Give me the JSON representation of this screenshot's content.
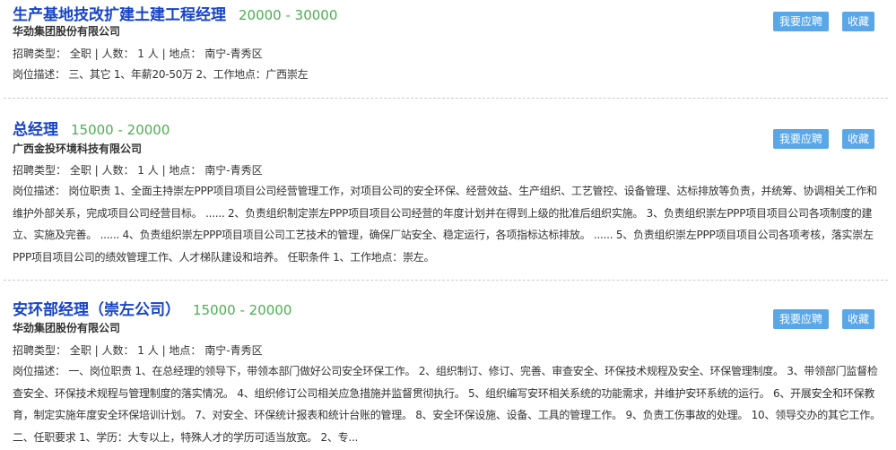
{
  "colors": {
    "title": "#1744c8",
    "salary": "#4caf50",
    "button": "#5aa7e8",
    "text": "#333333",
    "divider": "#cccccc"
  },
  "buttons": {
    "apply": "我要应聘",
    "favorite": "收藏"
  },
  "jobs": [
    {
      "title": "生产基地技改扩建土建工程经理",
      "salary": "20000 - 30000",
      "company": "华劲集团股份有限公司",
      "meta": "招聘类型： 全职 | 人数： 1 人 | 地点： 南宁-青秀区",
      "desc": "岗位描述： 三、其它 1、年薪20-50万 2、工作地点：广西崇左"
    },
    {
      "title": "总经理",
      "salary": "15000 - 20000",
      "company": "广西金投环境科技有限公司",
      "meta": "招聘类型： 全职 | 人数： 1 人 | 地点： 南宁-青秀区",
      "desc": "岗位描述： 岗位职责 1、全面主持崇左PPP项目项目公司经营管理工作，对项目公司的安全环保、经营效益、生产组织、工艺管控、设备管理、达标排放等负责，并统筹、协调相关工作和维护外部关系，完成项目公司经营目标。 ...... 2、负责组织制定崇左PPP项目项目公司经营的年度计划并在得到上级的批准后组织实施。 3、负责组织崇左PPP项目项目公司各项制度的建立、实施及完善。 ...... 4、负责组织崇左PPP项目项目公司工艺技术的管理，确保厂站安全、稳定运行，各项指标达标排放。 ...... 5、负责组织崇左PPP项目项目公司各项考核，落实崇左PPP项目项目公司的绩效管理工作、人才梯队建设和培养。 任职条件 1、工作地点：崇左。"
    },
    {
      "title": "安环部经理（崇左公司）",
      "salary": "15000 - 20000",
      "company": "华劲集团股份有限公司",
      "meta": "招聘类型： 全职 | 人数： 1 人 | 地点： 南宁-青秀区",
      "desc": "岗位描述： 一、岗位职责 1、在总经理的领导下，带领本部门做好公司安全环保工作。 2、组织制订、修订、完善、审查安全、环保技术规程及安全、环保管理制度。 3、带领部门监督检查安全、环保技术规程与管理制度的落实情况。 4、组织修订公司相关应急措施并监督贯彻执行。 5、组织编写安环相关系统的功能需求，并维护安环系统的运行。 6、开展安全和环保教育，制定实施年度安全环保培训计划。 7、对安全、环保统计报表和统计台账的管理。 8、安全环保设施、设备、工具的管理工作。 9、负责工伤事故的处理。 10、领导交办的其它工作。 二、任职要求 1、学历：大专以上，特殊人才的学历可适当放宽。 2、专..."
    }
  ]
}
